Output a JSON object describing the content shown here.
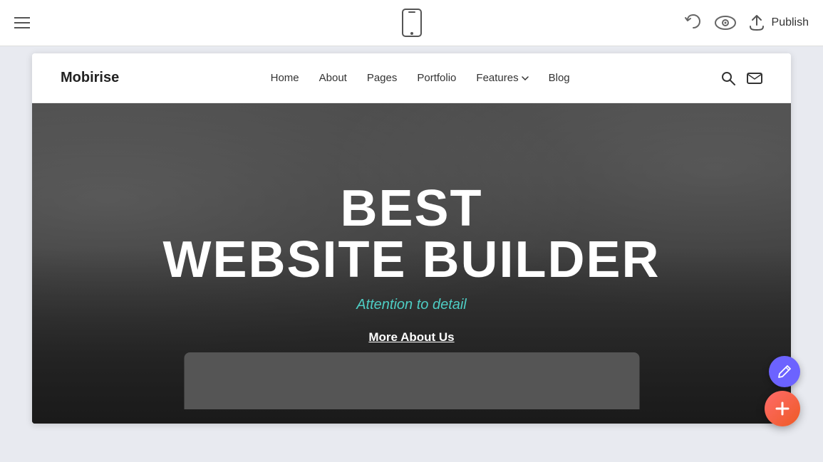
{
  "toolbar": {
    "hamburger_label": "menu",
    "phone_icon_label": "mobile-preview",
    "back_icon_label": "undo",
    "preview_icon_label": "preview",
    "publish_icon_label": "publish-icon",
    "publish_label": "Publish"
  },
  "site": {
    "logo": "Mobirise",
    "nav": {
      "links": [
        {
          "label": "Home",
          "id": "home"
        },
        {
          "label": "About",
          "id": "about"
        },
        {
          "label": "Pages",
          "id": "pages"
        },
        {
          "label": "Portfolio",
          "id": "portfolio"
        },
        {
          "label": "Features",
          "id": "features",
          "has_dropdown": true
        },
        {
          "label": "Blog",
          "id": "blog"
        }
      ]
    },
    "hero": {
      "title_line1": "BEST",
      "title_line2": "WEBSITE BUILDER",
      "subtitle": "Attention to detail",
      "cta_label": "More About Us"
    }
  },
  "floating_buttons": {
    "edit_icon": "pencil-icon",
    "add_icon": "plus-icon"
  }
}
